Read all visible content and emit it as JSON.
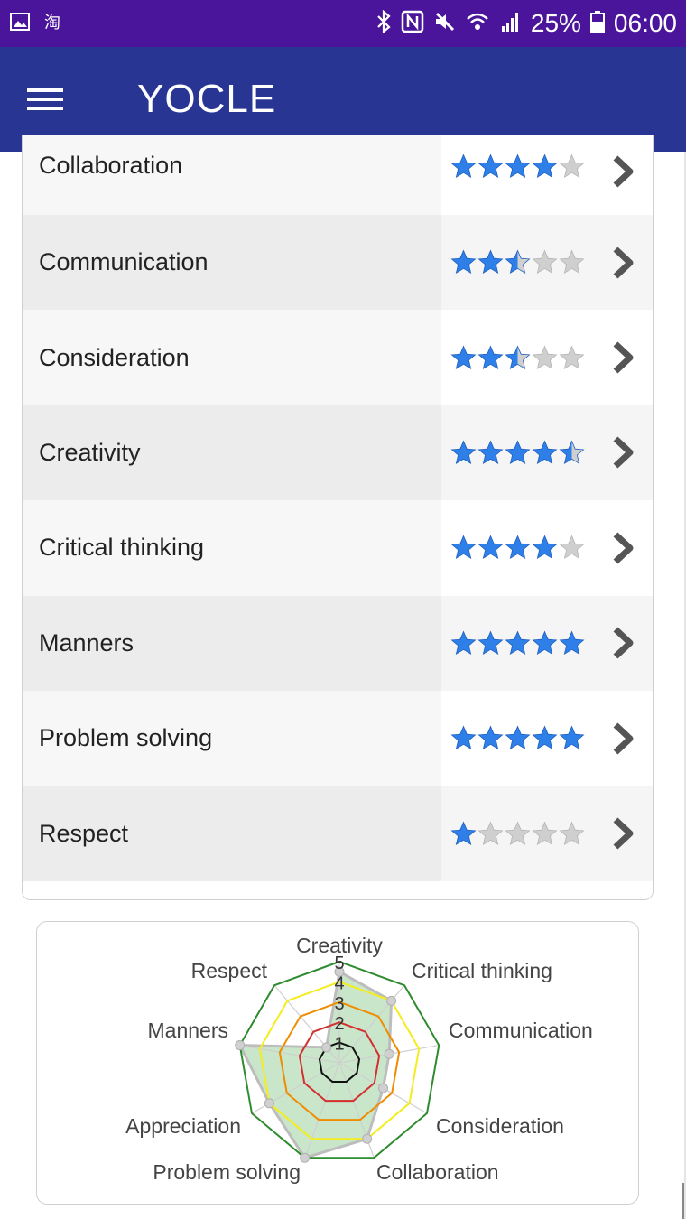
{
  "status_bar": {
    "battery": "25%",
    "time": "06:00",
    "left_icons": [
      "image-icon",
      "taobao-icon"
    ],
    "right_icons": [
      "bluetooth-icon",
      "nfc-icon",
      "mute-icon",
      "wifi-icon",
      "signal-icon",
      "battery-icon"
    ]
  },
  "app_bar": {
    "title": "YOCLE"
  },
  "colors": {
    "status_bar": "#4a159a",
    "app_bar": "#283593",
    "star_filled": "#2f7fe8",
    "star_empty": "#cfcfcf",
    "chevron": "#555555"
  },
  "skills": [
    {
      "name": "Collaboration",
      "rating": 4
    },
    {
      "name": "Communication",
      "rating": 2.5
    },
    {
      "name": "Consideration",
      "rating": 2.5
    },
    {
      "name": "Creativity",
      "rating": 4.5
    },
    {
      "name": "Critical thinking",
      "rating": 4
    },
    {
      "name": "Manners",
      "rating": 5
    },
    {
      "name": "Problem solving",
      "rating": 5
    },
    {
      "name": "Respect",
      "rating": 1
    }
  ],
  "chart_data": {
    "type": "radar",
    "axes": [
      "Creativity",
      "Critical thinking",
      "Communication",
      "Consideration",
      "Collaboration",
      "Problem solving",
      "Appreciation",
      "Manners",
      "Respect"
    ],
    "values": [
      4.5,
      4,
      2.5,
      2.5,
      4,
      5,
      4,
      5,
      1
    ],
    "tick_labels": [
      "1",
      "2",
      "3",
      "4",
      "5"
    ],
    "rmax": 5,
    "ring_colors": [
      "#111111",
      "#d32f2f",
      "#ef8c00",
      "#f5ec1d",
      "#2e8b2e"
    ],
    "fill_color": "#a5d6a7"
  }
}
